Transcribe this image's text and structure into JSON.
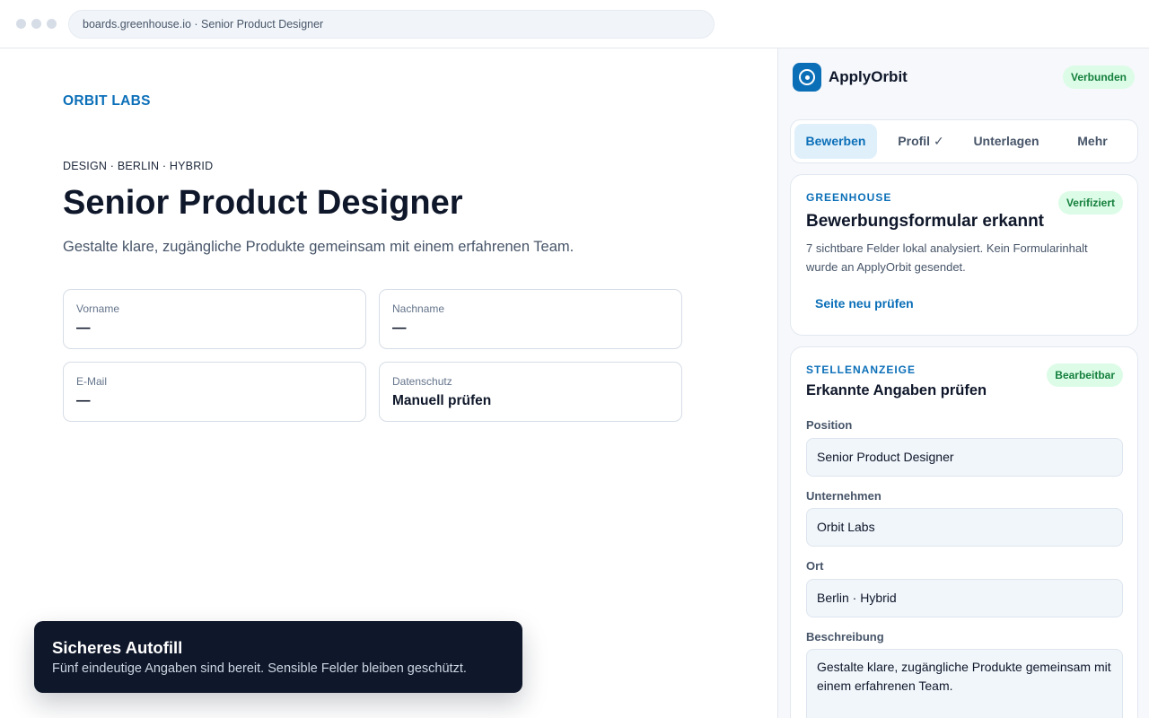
{
  "browser": {
    "url": "boards.greenhouse.io · Senior Product Designer",
    "window_controls": [
      "close",
      "minimize",
      "zoom"
    ]
  },
  "page": {
    "company": "ORBIT LABS",
    "meta": "DESIGN · BERLIN · HYBRID",
    "title": "Senior Product Designer",
    "subtitle": "Gestalte klare, zugängliche Produkte gemeinsam mit einem erfahrenen Team.",
    "fields": [
      {
        "label": "Vorname",
        "value": "—"
      },
      {
        "label": "Nachname",
        "value": "—"
      },
      {
        "label": "E-Mail",
        "value": "—"
      },
      {
        "label": "Datenschutz",
        "value": "Manuell prüfen"
      }
    ]
  },
  "toast": {
    "title": "Sicheres Autofill",
    "message": "Fünf eindeutige Angaben sind bereit. Sensible Felder bleiben geschützt."
  },
  "panel": {
    "app_name": "ApplyOrbit",
    "logo_icon": "orbit-icon",
    "status": "Verbunden",
    "tabs": [
      {
        "label": "Bewerben",
        "active": true
      },
      {
        "label": "Profil ✓",
        "active": false
      },
      {
        "label": "Unterlagen",
        "active": false
      },
      {
        "label": "Mehr",
        "active": false
      }
    ],
    "detection": {
      "eyebrow": "GREENHOUSE",
      "badge": "Verifiziert",
      "title": "Bewerbungsformular erkannt",
      "description": "7 sichtbare Felder lokal analysiert. Kein Formularinhalt wurde an ApplyOrbit gesendet.",
      "action": "Seite neu prüfen"
    },
    "job": {
      "eyebrow": "STELLENANZEIGE",
      "badge": "Bearbeitbar",
      "title": "Erkannte Angaben prüfen",
      "position_label": "Position",
      "position": "Senior Product Designer",
      "company_label": "Unternehmen",
      "company": "Orbit Labs",
      "location_label": "Ort",
      "location": "Berlin · Hybrid",
      "description_label": "Beschreibung",
      "description": "Gestalte klare, zugängliche Produkte gemeinsam mit einem erfahrenen Team."
    }
  },
  "colors": {
    "accent": "#0b6fb8",
    "success_bg": "#dcfce7",
    "success_text": "#15803d",
    "toast_bg": "#0f172a",
    "panel_bg": "#f6f8fb"
  }
}
